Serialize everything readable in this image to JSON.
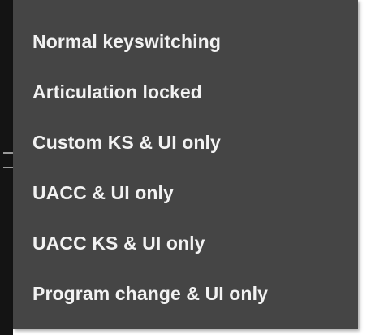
{
  "menu": {
    "items": [
      {
        "label": "Normal keyswitching"
      },
      {
        "label": "Articulation locked"
      },
      {
        "label": "Custom KS & UI only"
      },
      {
        "label": "UACC & UI only"
      },
      {
        "label": "UACC KS & UI only"
      },
      {
        "label": "Program change & UI only"
      }
    ]
  },
  "colors": {
    "menu_background": "#454545",
    "menu_text": "#f2f2f2",
    "underlying_ui": "#141414"
  }
}
